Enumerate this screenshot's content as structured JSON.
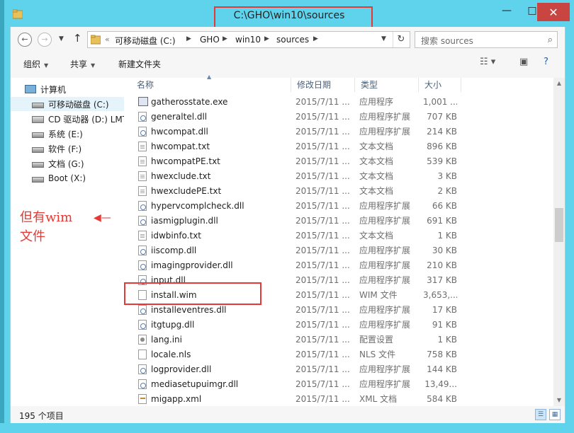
{
  "window": {
    "title": "C:\\GHO\\win10\\sources",
    "controls": {
      "minimize": "—",
      "maximize": "□",
      "close": "✕"
    }
  },
  "address": {
    "overflow": "«",
    "crumbs": [
      "可移动磁盘 (C:)",
      "GHO",
      "win10",
      "sources"
    ],
    "search_placeholder": "搜索 sources"
  },
  "toolbar": {
    "organize": "组织",
    "share": "共享",
    "new_folder": "新建文件夹"
  },
  "nav": {
    "items": [
      {
        "label": "计算机",
        "icon": "computer-icon"
      },
      {
        "label": "可移动磁盘 (C:)",
        "icon": "drive-icon"
      },
      {
        "label": "CD 驱动器 (D:) LMT",
        "icon": "cd-drive-icon"
      },
      {
        "label": "系统 (E:)",
        "icon": "drive-icon"
      },
      {
        "label": "软件 (F:)",
        "icon": "drive-icon"
      },
      {
        "label": "文档 (G:)",
        "icon": "drive-icon"
      },
      {
        "label": "Boot (X:)",
        "icon": "drive-icon"
      }
    ]
  },
  "columns": {
    "name": "名称",
    "date": "修改日期",
    "type": "类型",
    "size": "大小"
  },
  "files": [
    {
      "name": "gatherosstate.exe",
      "date": "2015/7/11 ...",
      "type": "应用程序",
      "size": "1,001 ...",
      "icon": "exe"
    },
    {
      "name": "generaltel.dll",
      "date": "2015/7/11 ...",
      "type": "应用程序扩展",
      "size": "707 KB",
      "icon": "dll"
    },
    {
      "name": "hwcompat.dll",
      "date": "2015/7/11 ...",
      "type": "应用程序扩展",
      "size": "214 KB",
      "icon": "dll"
    },
    {
      "name": "hwcompat.txt",
      "date": "2015/7/11 ...",
      "type": "文本文档",
      "size": "896 KB",
      "icon": "txt"
    },
    {
      "name": "hwcompatPE.txt",
      "date": "2015/7/11 ...",
      "type": "文本文档",
      "size": "539 KB",
      "icon": "txt"
    },
    {
      "name": "hwexclude.txt",
      "date": "2015/7/11 ...",
      "type": "文本文档",
      "size": "3 KB",
      "icon": "txt"
    },
    {
      "name": "hwexcludePE.txt",
      "date": "2015/7/11 ...",
      "type": "文本文档",
      "size": "2 KB",
      "icon": "txt"
    },
    {
      "name": "hypervcomplcheck.dll",
      "date": "2015/7/11 ...",
      "type": "应用程序扩展",
      "size": "66 KB",
      "icon": "dll"
    },
    {
      "name": "iasmigplugin.dll",
      "date": "2015/7/11 ...",
      "type": "应用程序扩展",
      "size": "691 KB",
      "icon": "dll"
    },
    {
      "name": "idwbinfo.txt",
      "date": "2015/7/11 ...",
      "type": "文本文档",
      "size": "1 KB",
      "icon": "txt"
    },
    {
      "name": "iiscomp.dll",
      "date": "2015/7/11 ...",
      "type": "应用程序扩展",
      "size": "30 KB",
      "icon": "dll"
    },
    {
      "name": "imagingprovider.dll",
      "date": "2015/7/11 ...",
      "type": "应用程序扩展",
      "size": "210 KB",
      "icon": "dll"
    },
    {
      "name": "input.dll",
      "date": "2015/7/11 ...",
      "type": "应用程序扩展",
      "size": "317 KB",
      "icon": "dll"
    },
    {
      "name": "install.wim",
      "date": "2015/7/11 ...",
      "type": "WIM 文件",
      "size": "3,653,...",
      "icon": "wim"
    },
    {
      "name": "installeventres.dll",
      "date": "2015/7/11 ...",
      "type": "应用程序扩展",
      "size": "17 KB",
      "icon": "dll"
    },
    {
      "name": "itgtupg.dll",
      "date": "2015/7/11 ...",
      "type": "应用程序扩展",
      "size": "91 KB",
      "icon": "dll"
    },
    {
      "name": "lang.ini",
      "date": "2015/7/11 ...",
      "type": "配置设置",
      "size": "1 KB",
      "icon": "ini"
    },
    {
      "name": "locale.nls",
      "date": "2015/7/11 ...",
      "type": "NLS 文件",
      "size": "758 KB",
      "icon": "nls"
    },
    {
      "name": "logprovider.dll",
      "date": "2015/7/11 ...",
      "type": "应用程序扩展",
      "size": "144 KB",
      "icon": "dll"
    },
    {
      "name": "mediasetupuimgr.dll",
      "date": "2015/7/11 ...",
      "type": "应用程序扩展",
      "size": "13,49...",
      "icon": "dll"
    },
    {
      "name": "migapp.xml",
      "date": "2015/7/11 ...",
      "type": "XML 文档",
      "size": "584 KB",
      "icon": "xml"
    }
  ],
  "status": {
    "count": "195 个项目"
  },
  "annotation": {
    "text": "但有wim\n文件"
  },
  "colors": {
    "title_bar": "#5fd3ec",
    "annotation_red": "#e53935",
    "close_button": "#c94542"
  }
}
